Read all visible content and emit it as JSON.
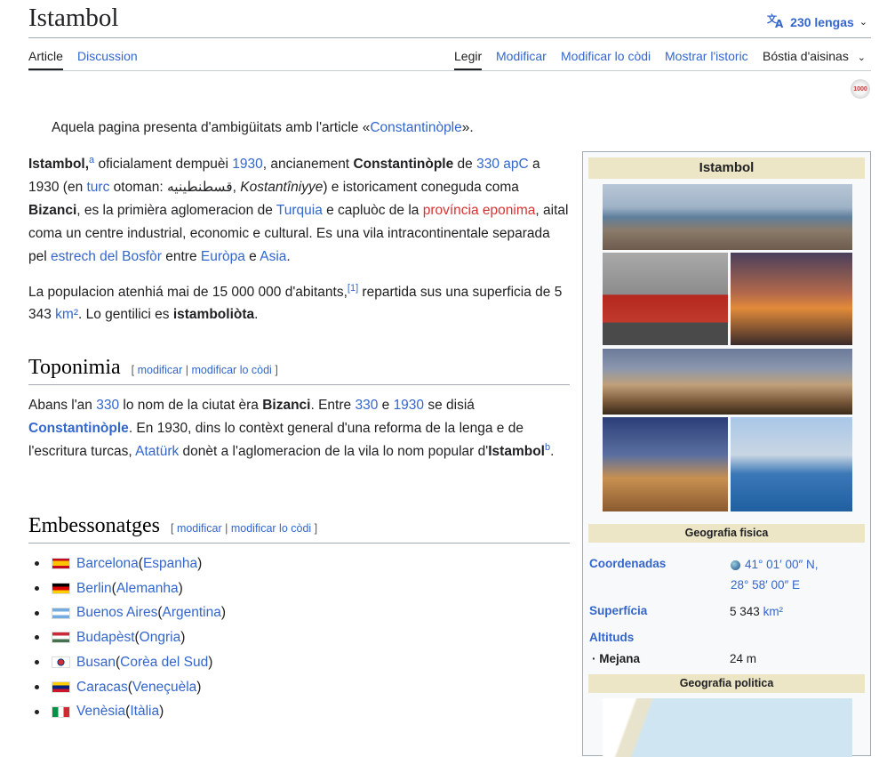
{
  "header": {
    "title": "Istambol",
    "languages_label": "230 lengas"
  },
  "tabs": {
    "article": "Article",
    "discussion": "Discussion",
    "read": "Legir",
    "edit": "Modificar",
    "edit_source": "Modificar lo còdi",
    "history": "Mostrar l'istoric",
    "tools": "Bóstia d'aisinas"
  },
  "badge": "1000",
  "hatnote": {
    "prefix": "Aquela pagina presenta d'ambigüitats amb l'article «",
    "link": "Constantinòple",
    "suffix": "»."
  },
  "intro": {
    "p1": {
      "t1": "Istambol,",
      "sup_a": "a",
      "t2": " oficialament dempuèi ",
      "l_1930": "1930",
      "t3": ", ancianement ",
      "b_const": "Constantinòple",
      "t4": " de ",
      "l_330": "330 apC",
      "t5": " a 1930 (en ",
      "l_turc": "turc",
      "t6": " otoman: قسطنطينيه, ",
      "i_kost": "Kostantîniyye",
      "t7": ") e istoricament coneguda coma ",
      "b_biz": "Bizanci",
      "t8": ", es la primièra aglomeracion de ",
      "l_turquia": "Turquia",
      "t9": " e capluòc de la ",
      "l_prov": "província eponima",
      "t10": ", aital coma un centre industrial, economic e cultural. Es una vila intracontinentale separada pel ",
      "l_bosfor": "estrech del Bosfòr",
      "t11": " entre ",
      "l_europa": "Euròpa",
      "t12": " e ",
      "l_asia": "Asia",
      "t13": "."
    },
    "p2": {
      "t1": "La populacion atenhiá mai de 15 000 000 d'abitants,",
      "ref": "[1]",
      "t2": " repartida sus una superficia de 5 343 ",
      "l_km": "km²",
      "t3": ". Lo gentilici es ",
      "b_gent": "istamboliòta",
      "t4": "."
    }
  },
  "toponimia": {
    "heading": "Toponimia",
    "edit_open": "[ ",
    "edit": "modificar",
    "sep": " | ",
    "edit_source": "modificar lo còdi",
    "edit_close": " ]",
    "t1": "Abans l'an ",
    "l_330": "330",
    "t2": " lo nom de la ciutat èra ",
    "b_biz": "Bizanci",
    "t3": ". Entre ",
    "l_330b": "330",
    "t4": " e ",
    "l_1930": "1930",
    "t5": " se disiá ",
    "l_const": "Constantinòple",
    "t6": ". En 1930, dins lo contèxt general d'una reforma de la lenga e de l'escritura turcas, ",
    "l_ataturk": "Atatürk",
    "t7": " donèt a l'aglomeracion de la vila lo nom popular d'",
    "b_ist": "Istambol",
    "sup_b": "b",
    "t8": "."
  },
  "embessonatges": {
    "heading": "Embessonatges",
    "edit_open": "[ ",
    "edit": "modificar",
    "sep": " | ",
    "edit_source": "modificar lo còdi",
    "edit_close": " ]",
    "items": [
      {
        "city": "Barcelona",
        "country": "Espanha",
        "open": " (",
        "close": ")"
      },
      {
        "city": "Berlin",
        "country": "Alemanha",
        "open": " (",
        "close": ")"
      },
      {
        "city": "Buenos Aires",
        "country": "Argentina",
        "open": " (",
        "close": ")"
      },
      {
        "city": "Budapèst",
        "country": "Ongria",
        "open": " (",
        "close": ")"
      },
      {
        "city": "Busan",
        "country": "Corèa del Sud",
        "open": " (",
        "close": ")"
      },
      {
        "city": "Caracas",
        "country": "Veneçuèla",
        "open": " (",
        "close": ")"
      },
      {
        "city": "Venèsia",
        "country": "Itàlia",
        "open": " (",
        "close": ")"
      }
    ]
  },
  "infobox": {
    "title": "Istambol",
    "section_geo": "Geografia fisica",
    "coord_label": "Coordenadas",
    "coord_line1": "41° 01′ 00″ N,",
    "coord_line2": "28° 58′ 00″ E",
    "area_label": "Superfícia",
    "area_value": "5 343",
    "area_unit": "km²",
    "alt_label": "Altituds",
    "alt_sub_label": "· Mejana",
    "alt_value": "24 m",
    "section_pol": "Geografia politica"
  },
  "colors": {
    "link": "#3366cc",
    "redlink": "#d73333",
    "infobox_header": "#ece5c6"
  }
}
